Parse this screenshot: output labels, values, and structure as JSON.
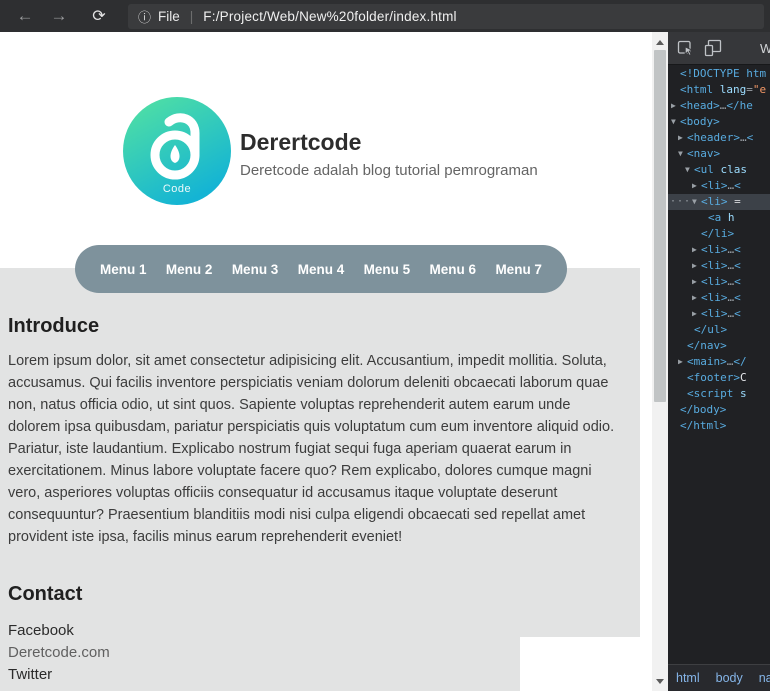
{
  "browser": {
    "back_icon": "←",
    "forward_icon": "→",
    "reload_icon": "⟳",
    "info_icon": "ⓘ",
    "file_label": "File",
    "separator": "|",
    "url": "F:/Project/Web/New%20folder/index.html"
  },
  "page": {
    "header": {
      "logo_caption": "Code",
      "title": "Derertcode",
      "subtitle": "Deretcode adalah blog tutorial pemrograman"
    },
    "menu": {
      "items": [
        "Menu 1",
        "Menu 2",
        "Menu 3",
        "Menu 4",
        "Menu 5",
        "Menu 6",
        "Menu 7"
      ]
    },
    "introduce": {
      "heading": "Introduce",
      "paragraph": "Lorem ipsum dolor, sit amet consectetur adipisicing elit. Accusantium, impedit mollitia. Soluta, accusamus. Qui facilis inventore perspiciatis veniam dolorum deleniti obcaecati laborum quae non, natus officia odio, ut sint quos. Sapiente voluptas reprehenderit autem earum unde dolorem ipsa quibusdam, pariatur perspiciatis quis voluptatum cum eum inventore aliquid odio. Pariatur, iste laudantium. Explicabo nostrum fugiat sequi fuga aperiam quaerat earum in exercitationem. Minus labore voluptate facere quo? Rem explicabo, dolores cumque magni vero, asperiores voluptas officiis consequatur id accusamus itaque voluptate deserunt consequuntur? Praesentium blanditiis modi nisi culpa eligendi obcaecati sed repellat amet provident iste ipsa, facilis minus earum reprehenderit eveniet!"
    },
    "contact": {
      "heading": "Contact",
      "links": [
        {
          "label": "Facebook",
          "dim": false
        },
        {
          "label": "Deretcode.com",
          "dim": true
        },
        {
          "label": "Twitter",
          "dim": false
        }
      ]
    }
  },
  "devtools": {
    "tab_label": "Welcome",
    "breadcrumb": [
      "html",
      "body",
      "nav"
    ],
    "dom_tree": [
      {
        "indent": 0,
        "arrow": "",
        "selected": false,
        "parts": [
          {
            "t": "tag",
            "s": "<!DOCTYPE htm"
          }
        ]
      },
      {
        "indent": 0,
        "arrow": "",
        "selected": false,
        "parts": [
          {
            "t": "tag",
            "s": "<html"
          },
          {
            "t": "attr",
            "s": " lang"
          },
          {
            "t": "punct",
            "s": "="
          },
          {
            "t": "val",
            "s": "\"e"
          }
        ]
      },
      {
        "indent": 0,
        "arrow": "r",
        "selected": false,
        "parts": [
          {
            "t": "tag",
            "s": "<head>"
          },
          {
            "t": "ellipsis",
            "s": "…"
          },
          {
            "t": "tag",
            "s": "</he"
          }
        ]
      },
      {
        "indent": 0,
        "arrow": "d",
        "selected": false,
        "parts": [
          {
            "t": "tag",
            "s": "<body>"
          }
        ]
      },
      {
        "indent": 1,
        "arrow": "r",
        "selected": false,
        "parts": [
          {
            "t": "tag",
            "s": "<header>"
          },
          {
            "t": "ellipsis",
            "s": "…"
          },
          {
            "t": "tag",
            "s": "<"
          }
        ]
      },
      {
        "indent": 1,
        "arrow": "d",
        "selected": false,
        "parts": [
          {
            "t": "tag",
            "s": "<nav>"
          }
        ]
      },
      {
        "indent": 2,
        "arrow": "d",
        "selected": false,
        "parts": [
          {
            "t": "tag",
            "s": "<ul"
          },
          {
            "t": "attr",
            "s": " clas"
          }
        ]
      },
      {
        "indent": 3,
        "arrow": "r",
        "selected": false,
        "parts": [
          {
            "t": "tag",
            "s": "<li>"
          },
          {
            "t": "ellipsis",
            "s": "…"
          },
          {
            "t": "tag",
            "s": "<"
          }
        ]
      },
      {
        "indent": 3,
        "arrow": "d",
        "selected": true,
        "parts": [
          {
            "t": "tag",
            "s": "<li>"
          },
          {
            "t": "marker",
            "s": " ="
          }
        ]
      },
      {
        "indent": 4,
        "arrow": "",
        "selected": false,
        "parts": [
          {
            "t": "tag",
            "s": "<a"
          },
          {
            "t": "attr",
            "s": " h"
          }
        ]
      },
      {
        "indent": 3,
        "arrow": "",
        "selected": false,
        "parts": [
          {
            "t": "tag",
            "s": "</li>"
          }
        ]
      },
      {
        "indent": 3,
        "arrow": "r",
        "selected": false,
        "parts": [
          {
            "t": "tag",
            "s": "<li>"
          },
          {
            "t": "ellipsis",
            "s": "…"
          },
          {
            "t": "tag",
            "s": "<"
          }
        ]
      },
      {
        "indent": 3,
        "arrow": "r",
        "selected": false,
        "parts": [
          {
            "t": "tag",
            "s": "<li>"
          },
          {
            "t": "ellipsis",
            "s": "…"
          },
          {
            "t": "tag",
            "s": "<"
          }
        ]
      },
      {
        "indent": 3,
        "arrow": "r",
        "selected": false,
        "parts": [
          {
            "t": "tag",
            "s": "<li>"
          },
          {
            "t": "ellipsis",
            "s": "…"
          },
          {
            "t": "tag",
            "s": "<"
          }
        ]
      },
      {
        "indent": 3,
        "arrow": "r",
        "selected": false,
        "parts": [
          {
            "t": "tag",
            "s": "<li>"
          },
          {
            "t": "ellipsis",
            "s": "…"
          },
          {
            "t": "tag",
            "s": "<"
          }
        ]
      },
      {
        "indent": 3,
        "arrow": "r",
        "selected": false,
        "parts": [
          {
            "t": "tag",
            "s": "<li>"
          },
          {
            "t": "ellipsis",
            "s": "…"
          },
          {
            "t": "tag",
            "s": "<"
          }
        ]
      },
      {
        "indent": 2,
        "arrow": "",
        "selected": false,
        "parts": [
          {
            "t": "tag",
            "s": "</ul>"
          }
        ]
      },
      {
        "indent": 1,
        "arrow": "",
        "selected": false,
        "parts": [
          {
            "t": "tag",
            "s": "</nav>"
          }
        ]
      },
      {
        "indent": 1,
        "arrow": "r",
        "selected": false,
        "parts": [
          {
            "t": "tag",
            "s": "<main>"
          },
          {
            "t": "ellipsis",
            "s": "…"
          },
          {
            "t": "tag",
            "s": "</"
          }
        ]
      },
      {
        "indent": 1,
        "arrow": "",
        "selected": false,
        "parts": [
          {
            "t": "tag",
            "s": "<footer>"
          },
          {
            "t": "text",
            "s": "C"
          }
        ]
      },
      {
        "indent": 1,
        "arrow": "",
        "selected": false,
        "parts": [
          {
            "t": "tag",
            "s": "<script"
          },
          {
            "t": "attr",
            "s": " s"
          }
        ]
      },
      {
        "indent": 0,
        "arrow": "",
        "selected": false,
        "parts": [
          {
            "t": "tag",
            "s": "</body>"
          }
        ]
      },
      {
        "indent": 0,
        "arrow": "",
        "selected": false,
        "parts": [
          {
            "t": "tag",
            "s": "</html>"
          }
        ]
      }
    ]
  },
  "colors": {
    "logo_gradient_top": "#55e3a0",
    "logo_gradient_bottom": "#14b4d4",
    "menu_background": "#7e929c",
    "section_gray": "#e2e3e3",
    "devtools_background": "#202124",
    "syntax_tag": "#58abdf",
    "syntax_attr": "#9cdcfe",
    "syntax_value": "#f29766",
    "selected_row": "#3c4148",
    "breadcrumb_link": "#85b5e8"
  }
}
